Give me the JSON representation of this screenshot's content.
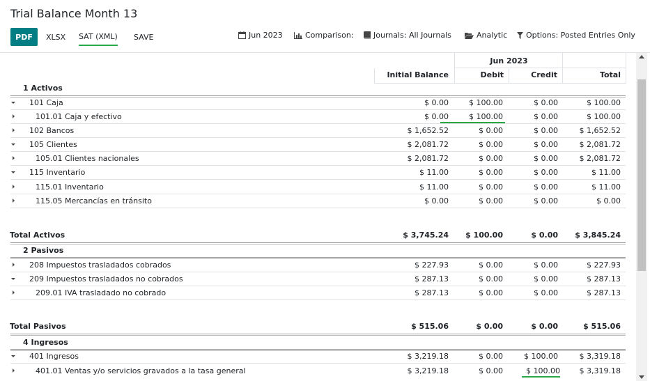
{
  "title": "Trial Balance Month 13",
  "buttons": {
    "pdf": "PDF",
    "xlsx": "XLSX",
    "sat_xml": "SAT (XML)",
    "save": "SAVE"
  },
  "filters": {
    "date": "Jun 2023",
    "comparison": "Comparison:",
    "journals": "Journals: All Journals",
    "analytic": "Analytic",
    "options": "Options: Posted Entries Only"
  },
  "columns": {
    "period": "Jun 2023",
    "initial_balance": "Initial Balance",
    "debit": "Debit",
    "credit": "Credit",
    "total": "Total"
  },
  "rows": [
    {
      "label": "1 Activos",
      "ib": "",
      "debit": "",
      "credit": "",
      "total": ""
    },
    {
      "label": "101 Caja",
      "ib": "$ 0.00",
      "debit": "$ 100.00",
      "credit": "$ 0.00",
      "total": "$ 100.00"
    },
    {
      "label": "101.01 Caja y efectivo",
      "ib": "$ 0.00",
      "debit": "$ 100.00",
      "credit": "$ 0.00",
      "total": "$ 100.00"
    },
    {
      "label": "102 Bancos",
      "ib": "$ 1,652.52",
      "debit": "$ 0.00",
      "credit": "$ 0.00",
      "total": "$ 1,652.52"
    },
    {
      "label": "105 Clientes",
      "ib": "$ 2,081.72",
      "debit": "$ 0.00",
      "credit": "$ 0.00",
      "total": "$ 2,081.72"
    },
    {
      "label": "105.01 Clientes nacionales",
      "ib": "$ 2,081.72",
      "debit": "$ 0.00",
      "credit": "$ 0.00",
      "total": "$ 2,081.72"
    },
    {
      "label": "115 Inventario",
      "ib": "$ 11.00",
      "debit": "$ 0.00",
      "credit": "$ 0.00",
      "total": "$ 11.00"
    },
    {
      "label": "115.01 Inventario",
      "ib": "$ 11.00",
      "debit": "$ 0.00",
      "credit": "$ 0.00",
      "total": "$ 11.00"
    },
    {
      "label": "115.05 Mercancías en tránsito",
      "ib": "$ 0.00",
      "debit": "$ 0.00",
      "credit": "$ 0.00",
      "total": "$ 0.00"
    },
    {
      "label": "Total Activos",
      "ib": "$ 3,745.24",
      "debit": "$ 100.00",
      "credit": "$ 0.00",
      "total": "$ 3,845.24"
    },
    {
      "label": "2 Pasivos",
      "ib": "",
      "debit": "",
      "credit": "",
      "total": ""
    },
    {
      "label": "208 Impuestos trasladados cobrados",
      "ib": "$ 227.93",
      "debit": "$ 0.00",
      "credit": "$ 0.00",
      "total": "$ 227.93"
    },
    {
      "label": "209 Impuestos trasladados no cobrados",
      "ib": "$ 287.13",
      "debit": "$ 0.00",
      "credit": "$ 0.00",
      "total": "$ 287.13"
    },
    {
      "label": "209.01 IVA trasladado no cobrado",
      "ib": "$ 287.13",
      "debit": "$ 0.00",
      "credit": "$ 0.00",
      "total": "$ 287.13"
    },
    {
      "label": "Total Pasivos",
      "ib": "$ 515.06",
      "debit": "$ 0.00",
      "credit": "$ 0.00",
      "total": "$ 515.06"
    },
    {
      "label": "4 Ingresos",
      "ib": "",
      "debit": "",
      "credit": "",
      "total": ""
    },
    {
      "label": "401 Ingresos",
      "ib": "$ 3,219.18",
      "debit": "$ 0.00",
      "credit": "$ 100.00",
      "total": "$ 3,319.18"
    },
    {
      "label": "401.01 Ventas y/o servicios gravados a la tasa general",
      "ib": "$ 3,219.18",
      "debit": "$ 0.00",
      "credit": "$ 100.00",
      "total": "$ 3,319.18"
    }
  ],
  "colors": {
    "primary": "#017e84",
    "underline": "#28a745"
  }
}
